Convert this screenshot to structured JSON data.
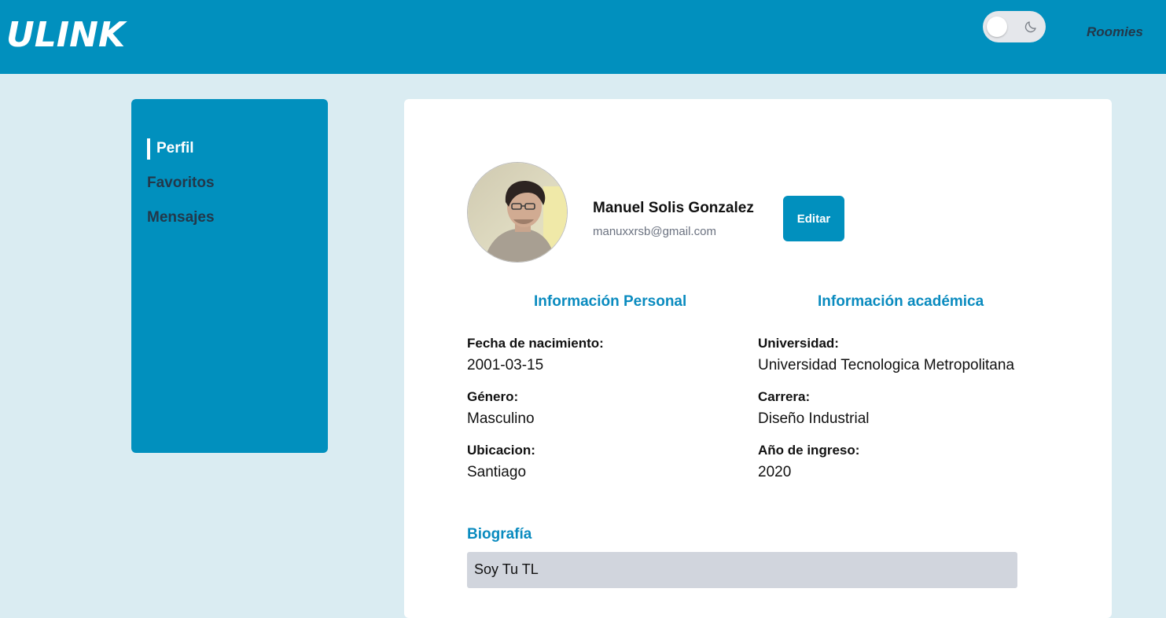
{
  "header": {
    "logo": "ULINK",
    "theme_toggle_icon": "moon-icon",
    "nav_link": "Roomies"
  },
  "sidebar": {
    "items": [
      {
        "label": "Perfil",
        "active": true
      },
      {
        "label": "Favoritos",
        "active": false
      },
      {
        "label": "Mensajes",
        "active": false
      }
    ]
  },
  "profile": {
    "name": "Manuel Solis Gonzalez",
    "email": "manuxxrsb@gmail.com",
    "edit_label": "Editar",
    "avatar_icon": "user-photo"
  },
  "personal": {
    "title": "Información Personal",
    "fields": [
      {
        "label": "Fecha de nacimiento:",
        "value": "2001-03-15"
      },
      {
        "label": "Género:",
        "value": "Masculino"
      },
      {
        "label": "Ubicacion:",
        "value": "Santiago"
      }
    ]
  },
  "academic": {
    "title": "Información académica",
    "fields": [
      {
        "label": "Universidad:",
        "value": "Universidad Tecnologica Metropolitana"
      },
      {
        "label": "Carrera:",
        "value": "Diseño Industrial"
      },
      {
        "label": "Año de ingreso:",
        "value": "2020"
      }
    ]
  },
  "bio": {
    "title": "Biografía",
    "text": "Soy Tu TL"
  },
  "colors": {
    "primary": "#0190be",
    "background": "#daecf2",
    "accent_text": "#0a8bbf",
    "bio_box": "#d1d5dd"
  }
}
